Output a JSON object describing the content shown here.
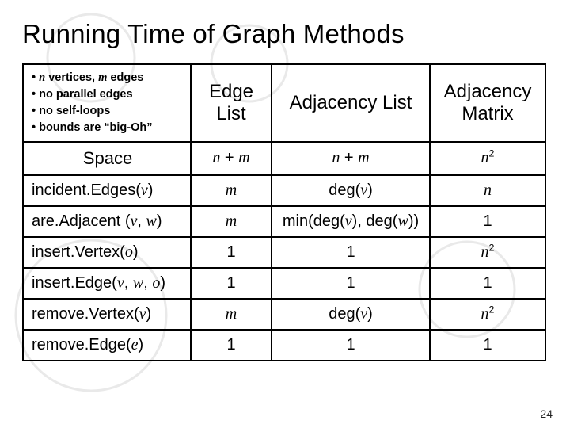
{
  "title": "Running Time of Graph Methods",
  "assumptions": {
    "line1_pre": "• ",
    "line1_n": "n",
    "line1_mid": " vertices, ",
    "line1_m": "m",
    "line1_post": " edges",
    "line2": "• no parallel edges",
    "line3": "• no self-loops",
    "line4": "• bounds are “big-Oh”"
  },
  "columns": {
    "edge_list": "Edge List",
    "adj_list": "Adjacency List",
    "adj_matrix": "Adjacency Matrix"
  },
  "rows": {
    "space": {
      "label": "Space",
      "edge_n": "n",
      "edge_plus": " + ",
      "edge_m": "m",
      "adjl_n": "n",
      "adjl_plus": " + ",
      "adjl_m": "m",
      "adjm_n": "n",
      "adjm_exp": "2"
    },
    "incident": {
      "label_pre": "incident.Edges(",
      "label_v": "v",
      "label_post": ")",
      "edge_m": "m",
      "adjl_pre": "deg(",
      "adjl_v": "v",
      "adjl_post": ")",
      "adjm_n": "n"
    },
    "areadj": {
      "label_pre": "are.Adjacent (",
      "label_v": "v",
      "label_comma1": ", ",
      "label_w": "w",
      "label_post": ")",
      "edge_m": "m",
      "adjl_pre": "min(deg(",
      "adjl_v": "v",
      "adjl_mid": "), deg(",
      "adjl_w": "w",
      "adjl_post": "))",
      "adjm": "1"
    },
    "insvert": {
      "label_pre": "insert.Vertex(",
      "label_o": "o",
      "label_post": ")",
      "edge": "1",
      "adjl": "1",
      "adjm_n": "n",
      "adjm_exp": "2"
    },
    "insedge": {
      "label_pre": "insert.Edge(",
      "label_v": "v",
      "label_c1": ", ",
      "label_w": "w",
      "label_c2": ", ",
      "label_o": "o",
      "label_post": ")",
      "edge": "1",
      "adjl": "1",
      "adjm": "1"
    },
    "remvert": {
      "label_pre": "remove.Vertex(",
      "label_v": "v",
      "label_post": ")",
      "edge_m": "m",
      "adjl_pre": "deg(",
      "adjl_v": "v",
      "adjl_post": ")",
      "adjm_n": "n",
      "adjm_exp": "2"
    },
    "remedge": {
      "label_pre": "remove.Edge(",
      "label_e": "e",
      "label_post": ")",
      "edge": "1",
      "adjl": "1",
      "adjm": "1"
    }
  },
  "page_number": "24"
}
